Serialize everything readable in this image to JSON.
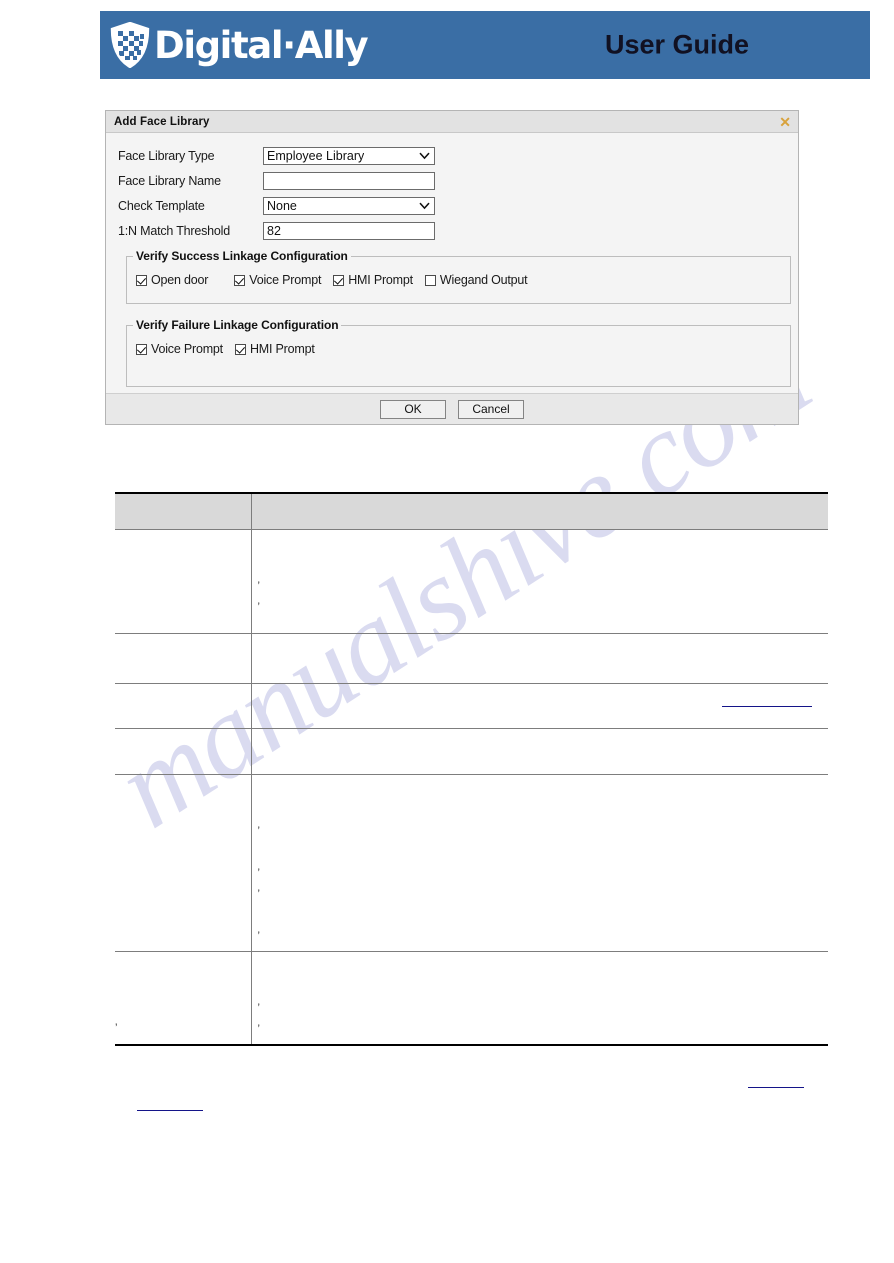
{
  "page": {
    "header": {
      "brand": "Digital·Ally",
      "guide_title": "User Guide",
      "banner_color": "#3a6ea5",
      "logo_icon": "shield-grid-logo-icon"
    },
    "watermark": "manualshive.com"
  },
  "dialog": {
    "title": "Add Face Library",
    "close_icon": "close-x-icon",
    "fields": [
      {
        "label": "Face Library Type",
        "type": "select",
        "value": "Employee Library",
        "icon": "chevron-down-icon"
      },
      {
        "label": "Face Library Name",
        "type": "text",
        "value": "",
        "placeholder": ""
      },
      {
        "label": "Check Template",
        "type": "select",
        "value": "None",
        "icon": "chevron-down-icon"
      },
      {
        "label": "1:N Match Threshold",
        "type": "text",
        "value": "82",
        "placeholder": ""
      }
    ],
    "success_group": {
      "legend": "Verify Success Linkage Configuration",
      "checkboxes": [
        {
          "label": "Open door",
          "checked": true
        },
        {
          "label": "Voice Prompt",
          "checked": true
        },
        {
          "label": "HMI Prompt",
          "checked": true
        },
        {
          "label": "Wiegand Output",
          "checked": false
        }
      ]
    },
    "failure_group": {
      "legend": "Verify Failure Linkage Configuration",
      "checkboxes": [
        {
          "label": "Voice Prompt",
          "checked": true
        },
        {
          "label": "HMI Prompt",
          "checked": true
        }
      ]
    },
    "buttons": {
      "ok": "OK",
      "cancel": "Cancel"
    }
  },
  "table": {
    "headers": [
      "",
      ""
    ],
    "rows": [
      {
        "name": "",
        "desc_lines": [
          "",
          "’",
          "’"
        ]
      },
      {
        "name": "",
        "desc_lines": [
          "",
          ""
        ]
      },
      {
        "name": "",
        "desc_lines": [
          "",
          ""
        ],
        "has_link": true
      },
      {
        "name": "",
        "desc_lines": [
          ""
        ]
      },
      {
        "name": "",
        "desc_lines": [
          "",
          "’",
          "",
          "’",
          "’",
          "",
          "’"
        ]
      },
      {
        "name": "",
        "desc_lines": [
          "",
          "’",
          "’"
        ]
      }
    ]
  },
  "notes": {
    "tick": "’"
  }
}
